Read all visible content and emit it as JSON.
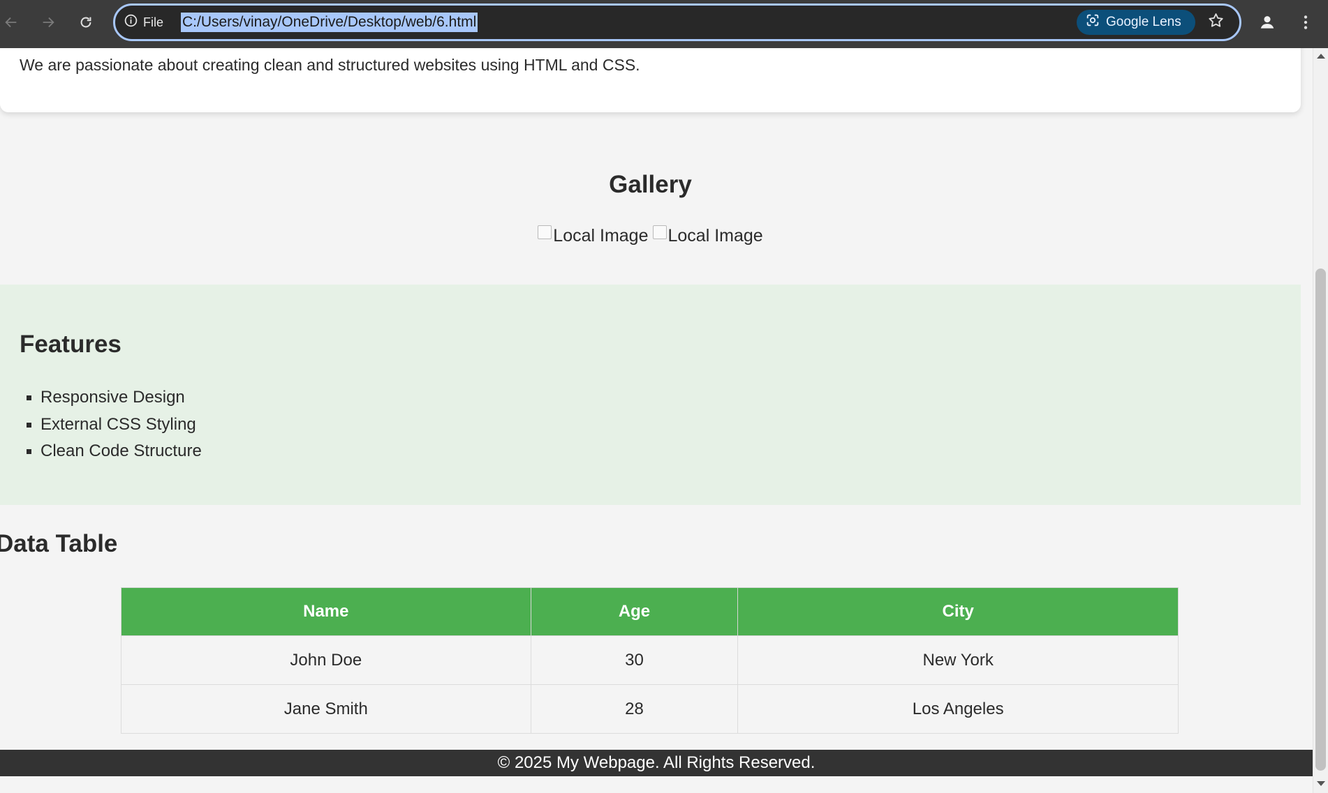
{
  "browser": {
    "site_info_label": "File",
    "url": "C:/Users/vinay/OneDrive/Desktop/web/6.html",
    "lens_label": "Google Lens",
    "icons": [
      "back-arrow-icon",
      "forward-arrow-icon",
      "reload-icon",
      "info-icon",
      "google-lens-icon",
      "bookmark-star-icon",
      "profile-icon",
      "more-vert-icon"
    ],
    "colors": {
      "toolbar": "#3c3c3c",
      "omnibox_border": "#a8c7fa",
      "url_selection": "#a8c7fa",
      "lens_bg": "#0c4f7a"
    }
  },
  "page": {
    "about_text": "We are passionate about creating clean and structured websites using HTML and CSS.",
    "gallery": {
      "title": "Gallery",
      "images": [
        {
          "alt": "Local Image"
        },
        {
          "alt": "Local Image"
        }
      ]
    },
    "features": {
      "title": "Features",
      "items": [
        "Responsive Design",
        "External CSS Styling",
        "Clean Code Structure"
      ],
      "background": "#e6f1e6"
    },
    "data_table": {
      "title": "Data Table",
      "headers": [
        "Name",
        "Age",
        "City"
      ],
      "rows": [
        [
          "John Doe",
          "30",
          "New York"
        ],
        [
          "Jane Smith",
          "28",
          "Los Angeles"
        ]
      ],
      "header_color": "#4caf50"
    },
    "footer_text": "© 2025 My Webpage. All Rights Reserved."
  }
}
